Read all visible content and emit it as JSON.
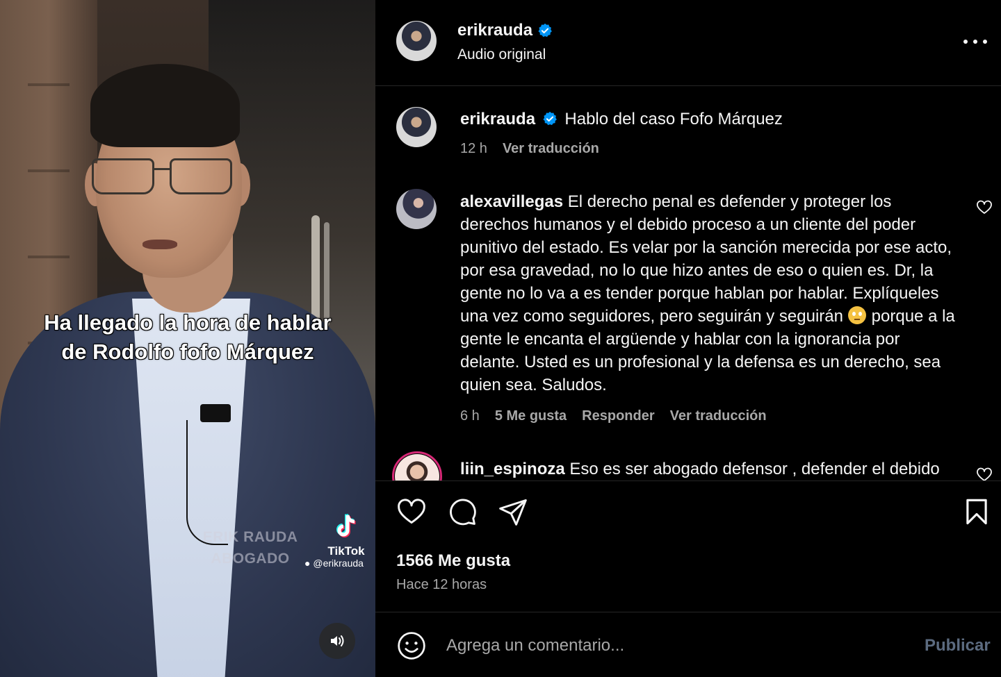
{
  "video": {
    "caption_lines": [
      "Ha llegado la hora de hablar",
      "de Rodolfo fofo Márquez"
    ],
    "watermark_lines": [
      "ERIK RAUDA",
      "ABOGADO"
    ],
    "tiktok_label": "TikTok",
    "tiktok_handle": "@erikrauda"
  },
  "header": {
    "username": "erikrauda",
    "subtitle": "Audio original"
  },
  "caption_post": {
    "username": "erikrauda",
    "text": "Hablo del caso Fofo Márquez",
    "age": "12 h",
    "translate": "Ver traducción"
  },
  "comments": [
    {
      "username": "alexavillegas",
      "text_before_emoji": "El derecho penal es defender y proteger los derechos humanos y el debido proceso a un cliente del poder punitivo del estado. Es velar por la sanción merecida por ese acto, por esa gravedad, no lo que hizo antes de eso o quien es. Dr, la gente no lo va a es tender porque hablan por hablar. Explíqueles una vez como seguidores, pero seguirán y seguirán",
      "text_after_emoji": "porque a la gente le encanta el argüende y hablar con la ignorancia por delante. Usted es un profesional y la defensa es un derecho, sea quien sea. Saludos.",
      "age": "6 h",
      "likes": "5 Me gusta",
      "reply": "Responder",
      "translate": "Ver traducción"
    },
    {
      "username": "liin_espinoza",
      "text": "Eso es ser abogado defensor , defender el debido"
    }
  ],
  "footer": {
    "likes": "1566 Me gusta",
    "time": "Hace 12 horas",
    "comment_placeholder": "Agrega un comentario...",
    "publish": "Publicar"
  },
  "colors": {
    "background": "#000000",
    "text": "#f5f5f5",
    "secondary": "#a8a8a8",
    "verified": "#0095f6",
    "publish_disabled": "#5c6b80"
  }
}
